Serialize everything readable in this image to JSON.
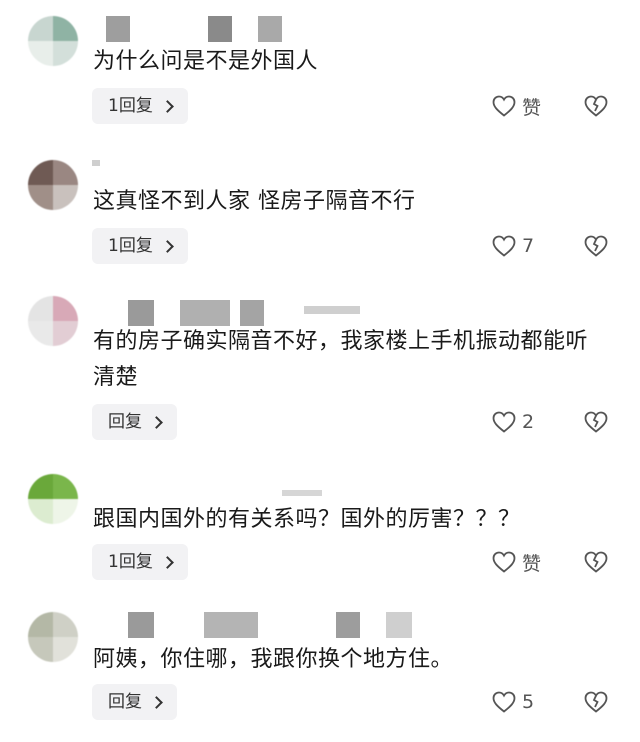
{
  "comments": [
    {
      "text": "为什么问是不是外国人",
      "reply_label": "1回复",
      "like_label": "赞",
      "avatar_colors": [
        "#c8d6d0",
        "#8fb3a4",
        "#e8eeea",
        "#d3dfda"
      ]
    },
    {
      "text": "这真怪不到人家 怪房子隔音不行",
      "reply_label": "1回复",
      "like_label": "7",
      "avatar_colors": [
        "#6f5a54",
        "#9a8782",
        "#a08f88",
        "#c9c1bd"
      ]
    },
    {
      "text": "有的房子确实隔音不好，我家楼上手机振动都能听清楚",
      "reply_label": "回复",
      "like_label": "2",
      "avatar_colors": [
        "#e4e4e4",
        "#d8a9b7",
        "#e9e9e9",
        "#e2cdd4"
      ]
    },
    {
      "text": "跟国内国外的有关系吗？国外的厉害？？？",
      "reply_label": "1回复",
      "like_label": "赞",
      "avatar_colors": [
        "#6aa83a",
        "#7ab64b",
        "#dcecd0",
        "#eef5e8"
      ]
    },
    {
      "text": "阿姨，你住哪，我跟你换个地方住。",
      "reply_label": "回复",
      "like_label": "5",
      "avatar_colors": [
        "#b4b8a6",
        "#cfd0c6",
        "#c6c8bb",
        "#e1e1da"
      ]
    }
  ],
  "colors": {
    "background": "#ffffff",
    "text": "#1a1a1a",
    "button_bg": "#f2f2f4",
    "icon": "#666666"
  },
  "icons": {
    "like": "heart-icon",
    "dislike": "broken-heart-icon",
    "reply_arrow": "chevron-right-icon"
  }
}
